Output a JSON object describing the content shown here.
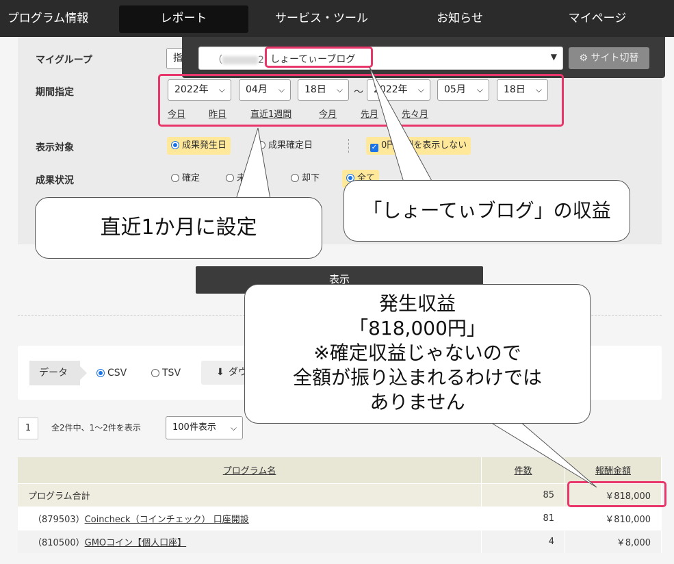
{
  "nav": {
    "items": [
      "プログラム情報",
      "レポート",
      "サービス・ツール",
      "お知らせ",
      "マイページ"
    ],
    "active_index": 1
  },
  "site_select": {
    "prefix": "（",
    "suffix": "2）",
    "site_name": "しょーてぃーブログ",
    "switch_label": "サイト切替"
  },
  "form": {
    "my_group_label": "マイグループ",
    "my_group_value": "指",
    "period_label": "期間指定",
    "from": {
      "year": "2022年",
      "month": "04月",
      "day": "18日"
    },
    "tilde": "～",
    "to": {
      "year": "2022年",
      "month": "05月",
      "day": "18日"
    },
    "quick_links": [
      "今日",
      "昨日",
      "直近1週間",
      "今月",
      "先月",
      "先々月"
    ],
    "display_target_label": "表示対象",
    "display_target_options": [
      "成果発生日",
      "成果確定日"
    ],
    "zero_option": "0円報酬を表示しない",
    "status_label": "成果状況",
    "status_options": [
      "確定",
      "未確定",
      "却下",
      "全て"
    ]
  },
  "show_button": "表示",
  "download": {
    "data_label": "データ",
    "formats": [
      "CSV",
      "TSV"
    ],
    "download_label": "ダウ"
  },
  "pagination": {
    "page": "1",
    "summary": "全2件中、1～2件を表示",
    "per_page": "100件表示"
  },
  "table": {
    "headers": [
      "プログラム名",
      "件数",
      "報酬金額"
    ],
    "total": {
      "name": "プログラム合計",
      "count": "85",
      "amount": "￥818,000"
    },
    "rows": [
      {
        "id": "（879503）",
        "name": "Coincheck（コインチェック） 口座開設",
        "count": "81",
        "amount": "￥810,000"
      },
      {
        "id": "（810500）",
        "name": "GMOコイン【個人口座】",
        "count": "4",
        "amount": "￥8,000"
      }
    ]
  },
  "annotations": {
    "period": "直近1か月に設定",
    "site": "「しょーてぃブログ」の収益",
    "earnings": [
      "発生収益",
      "「818,000円」",
      "※確定収益じゃないので",
      "全額が振り込まれるわけでは",
      "ありません"
    ]
  },
  "colors": {
    "highlight": "#e8356a",
    "nav_bg": "#2b2b2b",
    "option_highlight": "#ffe89a",
    "table_header": "#e8e6d5"
  }
}
